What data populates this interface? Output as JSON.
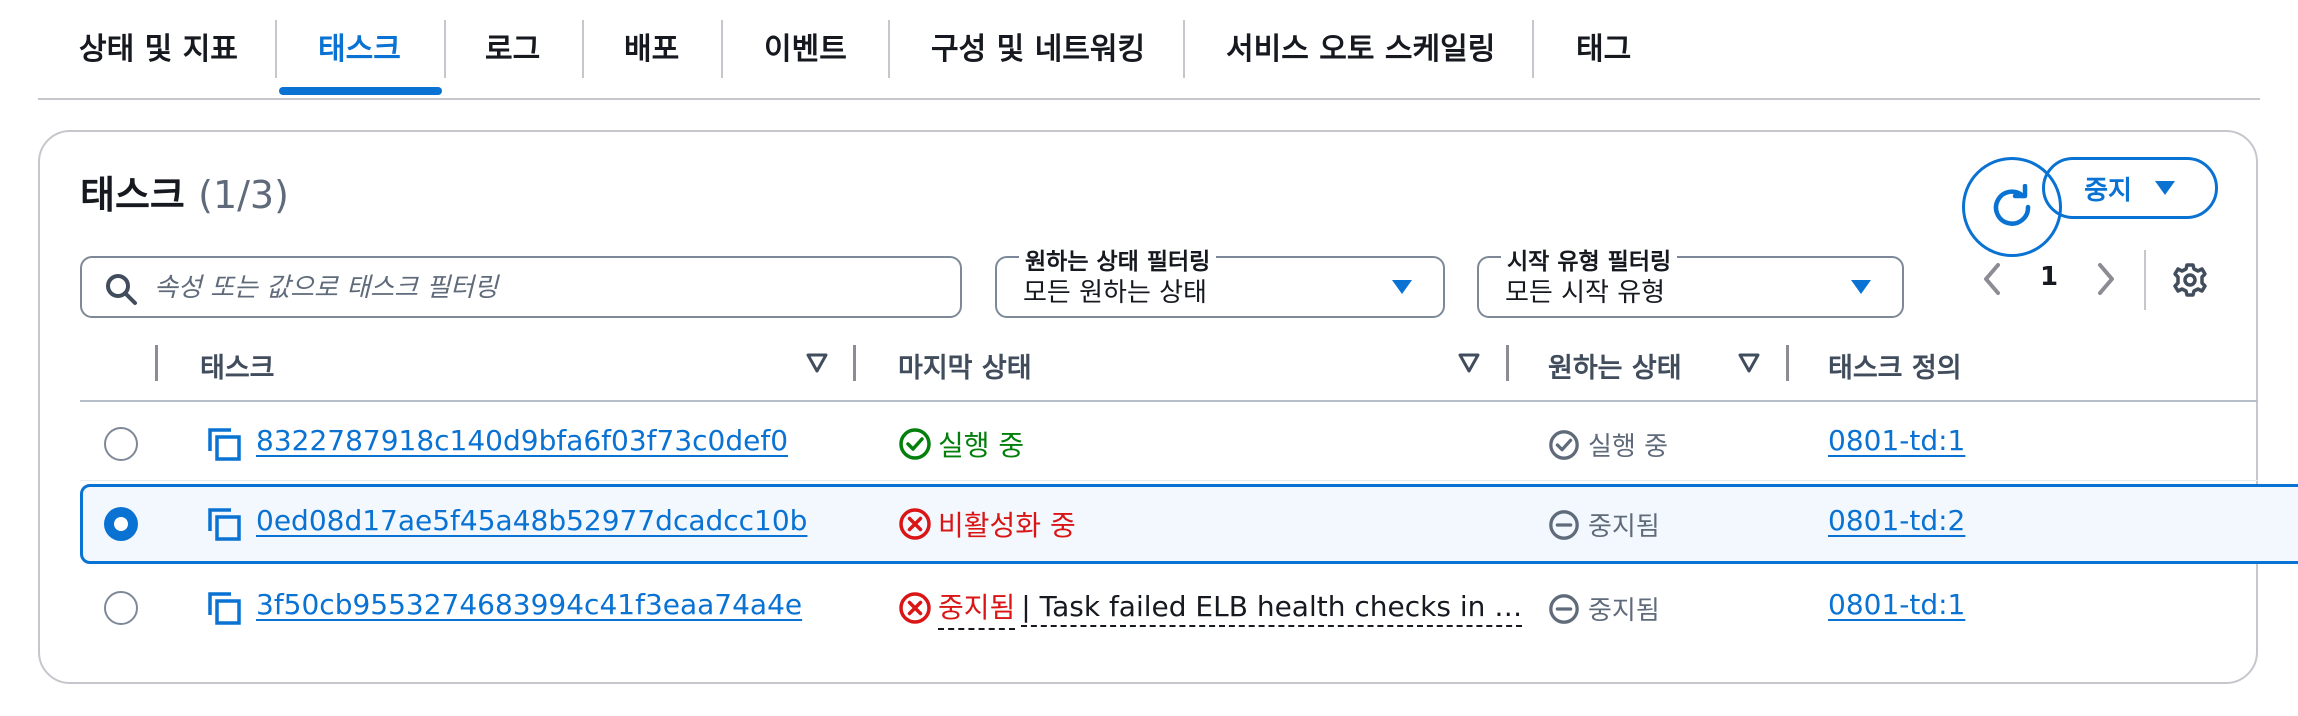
{
  "tabs": [
    {
      "label": "상태 및 지표",
      "active": false
    },
    {
      "label": "태스크",
      "active": true
    },
    {
      "label": "로그",
      "active": false
    },
    {
      "label": "배포",
      "active": false
    },
    {
      "label": "이벤트",
      "active": false
    },
    {
      "label": "구성 및 네트워킹",
      "active": false
    },
    {
      "label": "서비스 오토 스케일링",
      "active": false
    },
    {
      "label": "태그",
      "active": false
    }
  ],
  "panel": {
    "title": "태스크",
    "count": "(1/3)",
    "stop_label": "중지",
    "search_placeholder": "속성 또는 값으로 태스크 필터링",
    "filters": {
      "desired": {
        "label": "원하는 상태 필터링",
        "value": "모든 원하는 상태"
      },
      "launch": {
        "label": "시작 유형 필터링",
        "value": "모든 시작 유형"
      }
    },
    "page": "1"
  },
  "columns": [
    "태스크",
    "마지막 상태",
    "원하는 상태",
    "태스크 정의"
  ],
  "rows": [
    {
      "selected": false,
      "task": "8322787918c140d9bfa6f03f73c0def0",
      "last_status": "실행 중",
      "last_status_kind": "success",
      "reason": "",
      "desired": "실행 중",
      "desired_kind": "running",
      "definition": "0801-td:1"
    },
    {
      "selected": true,
      "task": "0ed08d17ae5f45a48b52977dcadcc10b",
      "last_status": "비활성화 중",
      "last_status_kind": "error",
      "reason": "",
      "desired": "중지됨",
      "desired_kind": "stopped",
      "definition": "0801-td:2"
    },
    {
      "selected": false,
      "task": "3f50cb9553274683994c41f3eaa74a4e",
      "last_status": "중지됨",
      "last_status_kind": "error",
      "reason": "| Task failed ELB health checks in …",
      "desired": "중지됨",
      "desired_kind": "stopped",
      "definition": "0801-td:1"
    }
  ],
  "colors": {
    "accent": "#0972d3",
    "success": "#037f0c",
    "error": "#d91515",
    "muted": "#5f6b7a"
  }
}
